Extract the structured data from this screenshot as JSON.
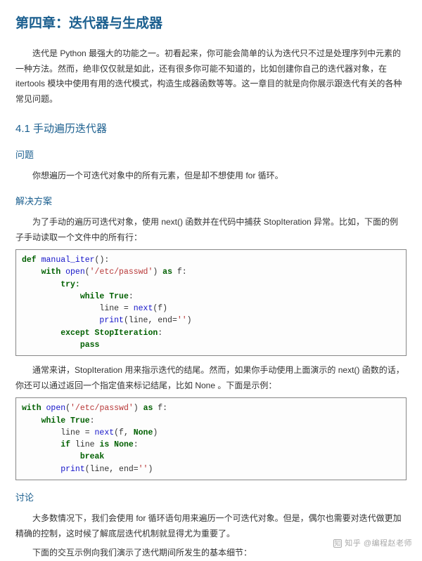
{
  "chapter_title": "第四章：迭代器与生成器",
  "intro": "迭代是 Python 最强大的功能之一。初看起来，你可能会简单的认为迭代只不过是处理序列中元素的一种方法。然而，绝非仅仅就是如此，还有很多你可能不知道的，比如创建你自己的迭代器对象，在 itertools 模块中使用有用的迭代模式，构造生成器函数等等。这一章目的就是向你展示跟迭代有关的各种常见问题。",
  "section_title": "4.1 手动遍历迭代器",
  "problem_heading": "问题",
  "problem_text": "你想遍历一个可迭代对象中的所有元素，但是却不想使用 for 循环。",
  "solution_heading": "解决方案",
  "solution_intro": "为了手动的遍历可迭代对象，使用 next() 函数并在代码中捕获 StopIteration 异常。比如，下面的例子手动读取一个文件中的所有行：",
  "solution_mid": "通常来讲，StopIteration 用来指示迭代的结尾。然而，如果你手动使用上面演示的 next() 函数的话，你还可以通过返回一个指定值来标记结尾，比如 None 。下面是示例：",
  "discussion_heading": "讨论",
  "discussion_p1": "大多数情况下，我们会使用 for 循环语句用来遍历一个可迭代对象。但是，偶尔也需要对迭代做更加精确的控制，这时候了解底层迭代机制就显得尤为重要了。",
  "discussion_p2": "下面的交互示例向我们演示了迭代期间所发生的基本细节：",
  "code1": {
    "def": "def",
    "fn1": "manual_iter",
    "with": "with",
    "open": "open",
    "path": "'/etc/passwd'",
    "as": "as",
    "try": "try:",
    "while": "while",
    "true": "True",
    "next": "next",
    "print": "print",
    "end": "''",
    "except": "except",
    "stopit": "StopIteration",
    "pass": "pass"
  },
  "code2": {
    "with": "with",
    "open": "open",
    "path": "'/etc/passwd'",
    "as": "as",
    "while": "while",
    "true": "True",
    "next": "next",
    "none": "None",
    "if": "if",
    "is": "is",
    "break": "break",
    "print": "print",
    "end": "''"
  },
  "watermark": "@编程赵老师",
  "watermark_brand": "知乎"
}
